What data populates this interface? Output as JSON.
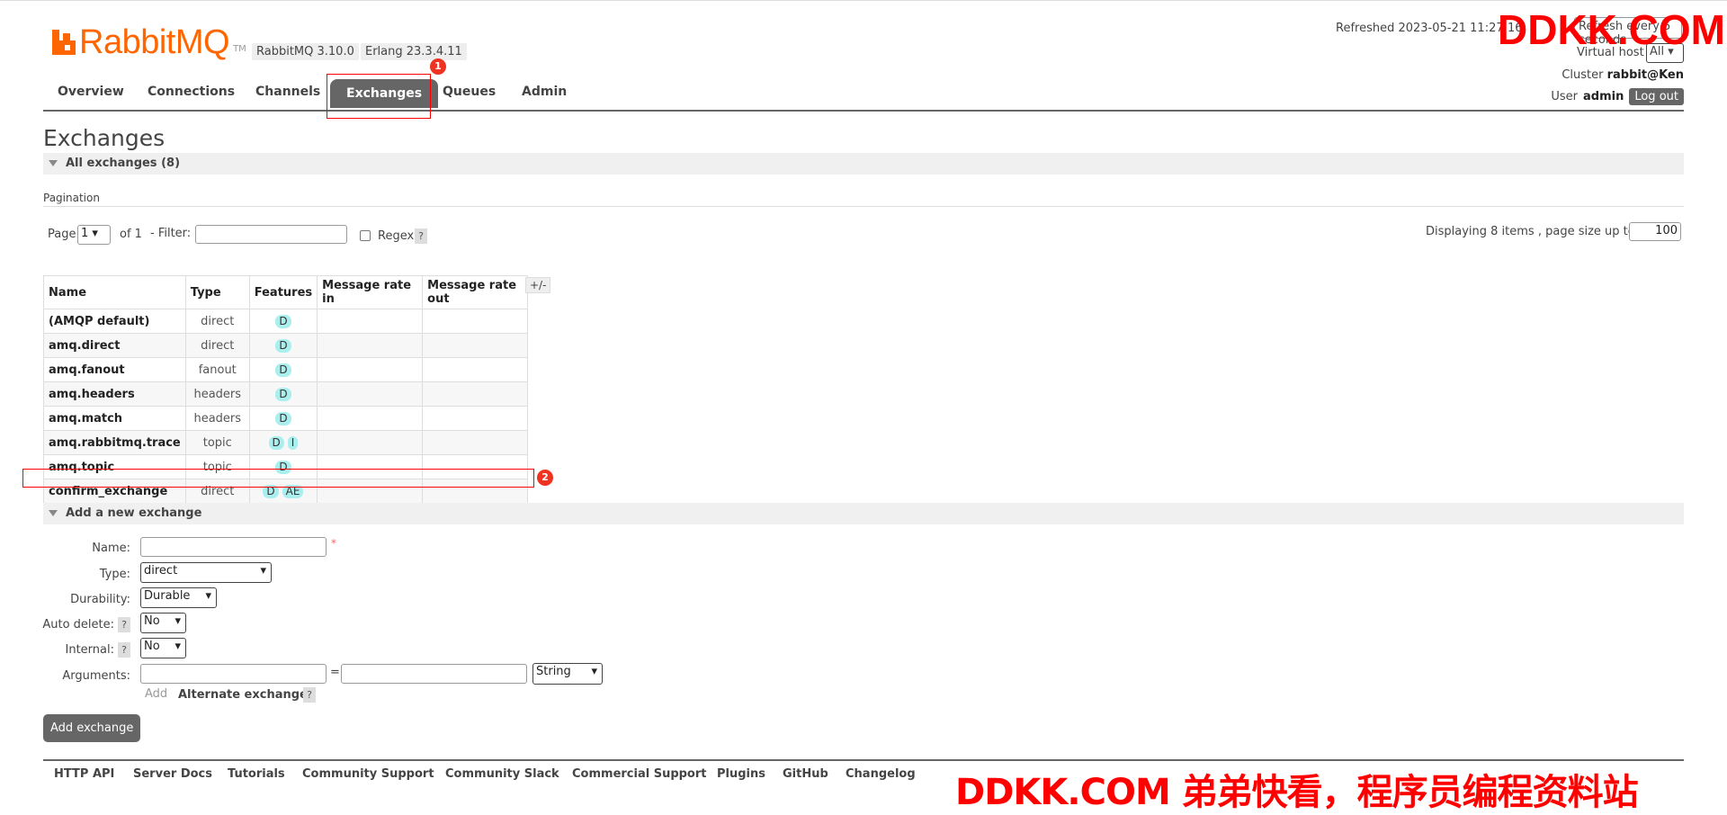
{
  "header": {
    "app_name": "RabbitMQ",
    "tm": "TM",
    "version": "RabbitMQ 3.10.0",
    "erlang": "Erlang 23.3.4.11",
    "refreshed": "Refreshed 2023-05-21 11:27:16",
    "refresh_select": "Refresh every 5 seconds",
    "vhost_label": "Virtual host",
    "vhost_value": "All",
    "cluster_label": "Cluster",
    "cluster_name": "rabbit@Ken",
    "user_label": "User",
    "user_name": "admin",
    "logout": "Log out"
  },
  "watermark": {
    "top": "DDKK.COM",
    "bottom": "DDKK.COM 弟弟快看，程序员编程资料站"
  },
  "tabs": [
    "Overview",
    "Connections",
    "Channels",
    "Exchanges",
    "Queues",
    "Admin"
  ],
  "active_tab": "Exchanges",
  "annotations": [
    "1",
    "2"
  ],
  "page_title": "Exchanges",
  "all_exchanges": "All exchanges (8)",
  "pagination": {
    "label": "Pagination",
    "page_label": "Page",
    "page_value": "1",
    "of": "of 1",
    "filter_label": "- Filter:",
    "regex_label": "Regex",
    "help": "?",
    "displaying": "Displaying 8 items , page size up to:",
    "page_size": "100"
  },
  "table": {
    "columns": [
      "Name",
      "Type",
      "Features",
      "Message rate in",
      "Message rate out"
    ],
    "plusminus": "+/-",
    "rows": [
      {
        "name": "(AMQP default)",
        "type": "direct",
        "features": [
          "D"
        ]
      },
      {
        "name": "amq.direct",
        "type": "direct",
        "features": [
          "D"
        ]
      },
      {
        "name": "amq.fanout",
        "type": "fanout",
        "features": [
          "D"
        ]
      },
      {
        "name": "amq.headers",
        "type": "headers",
        "features": [
          "D"
        ]
      },
      {
        "name": "amq.match",
        "type": "headers",
        "features": [
          "D"
        ]
      },
      {
        "name": "amq.rabbitmq.trace",
        "type": "topic",
        "features": [
          "D",
          "I"
        ]
      },
      {
        "name": "amq.topic",
        "type": "topic",
        "features": [
          "D"
        ]
      },
      {
        "name": "confirm_exchange",
        "type": "direct",
        "features": [
          "D",
          "AE"
        ]
      }
    ]
  },
  "add_section": {
    "title": "Add a new exchange",
    "name_label": "Name:",
    "required": "*",
    "type_label": "Type:",
    "type_value": "direct",
    "durability_label": "Durability:",
    "durability_value": "Durable",
    "auto_delete_label": "Auto delete:",
    "auto_delete_value": "No",
    "internal_label": "Internal:",
    "internal_value": "No",
    "arguments_label": "Arguments:",
    "equals": "=",
    "arg_type": "String",
    "add": "Add",
    "alternate_exchange": "Alternate exchange",
    "submit": "Add exchange"
  },
  "footer": [
    "HTTP API",
    "Server Docs",
    "Tutorials",
    "Community Support",
    "Community Slack",
    "Commercial Support",
    "Plugins",
    "GitHub",
    "Changelog"
  ]
}
